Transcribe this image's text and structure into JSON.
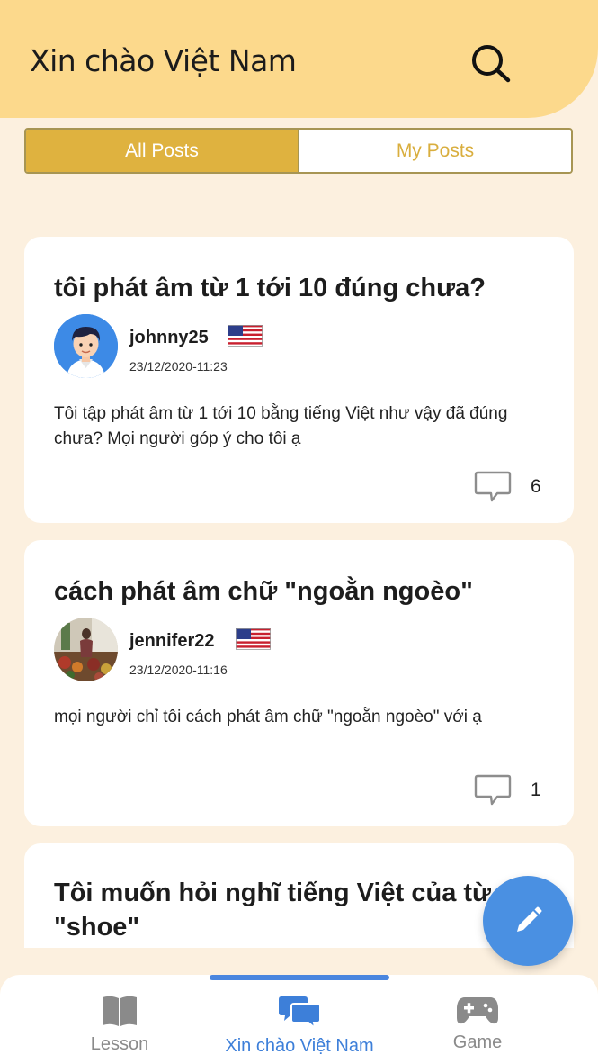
{
  "header": {
    "title": "Xin chào Việt Nam"
  },
  "segment": {
    "all_posts": "All Posts",
    "my_posts": "My Posts"
  },
  "posts": [
    {
      "title": "tôi phát âm từ 1 tới 10 đúng chưa?",
      "username": "johnny25",
      "timestamp": "23/12/2020-11:23",
      "body": "Tôi tập phát âm từ 1 tới 10 bằng tiếng Việt như vậy đã đúng chưa? Mọi người góp ý cho tôi ạ",
      "comment_count": "6",
      "flag": "us-flag"
    },
    {
      "title": "cách phát âm chữ \"ngoằn ngoèo\"",
      "username": "jennifer22",
      "timestamp": "23/12/2020-11:16",
      "body": "mọi người chỉ tôi cách phát âm chữ \"ngoằn ngoèo\" với ạ",
      "comment_count": "1",
      "flag": "us-flag"
    },
    {
      "title": "Tôi muốn hỏi nghĩ tiếng Việt của từ \"shoe\""
    }
  ],
  "nav": {
    "lesson": "Lesson",
    "community": "Xin chào Việt Nam",
    "game": "Game"
  },
  "colors": {
    "header": "#FCD98C",
    "background": "#FCF0DF",
    "accent_gold": "#DFB23F",
    "accent_blue": "#4A90E2"
  }
}
